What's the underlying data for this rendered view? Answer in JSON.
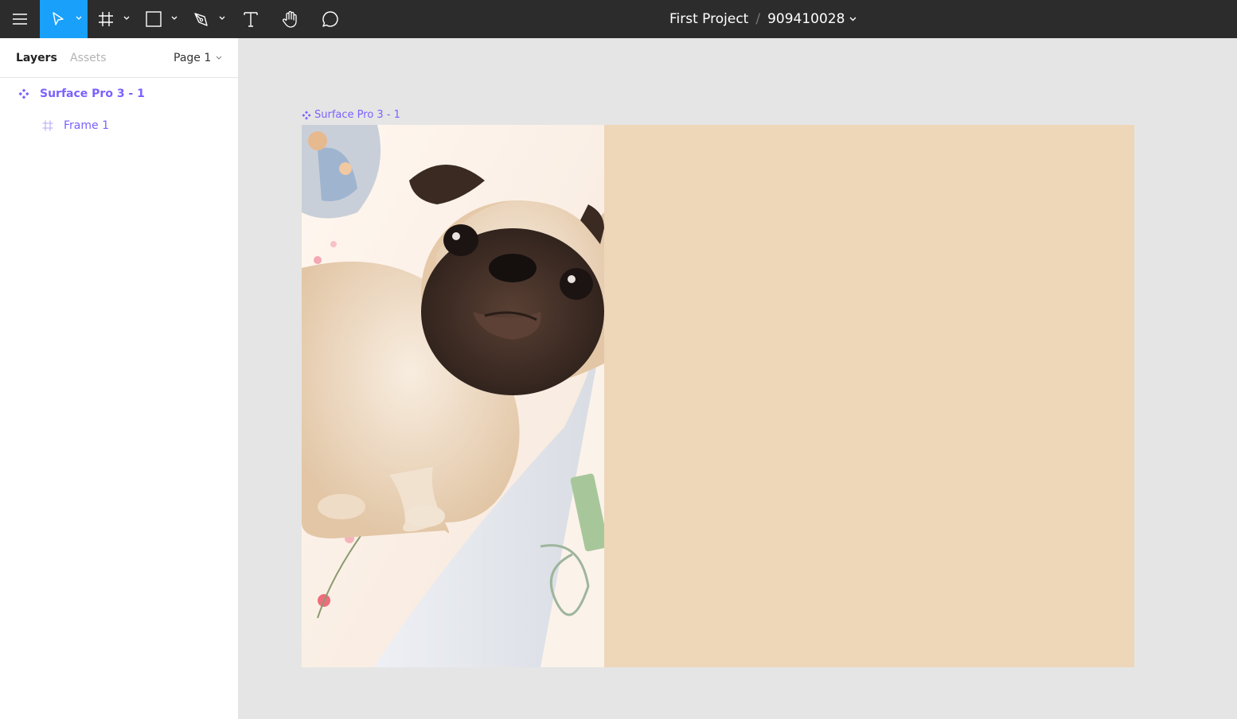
{
  "toolbar": {
    "project_name": "First Project",
    "separator": "/",
    "file_name": "909410028",
    "tools": [
      {
        "icon": "menu-icon"
      },
      {
        "icon": "move-tool-icon",
        "active": true
      },
      {
        "icon": "frame-tool-icon"
      },
      {
        "icon": "rectangle-tool-icon"
      },
      {
        "icon": "pen-tool-icon"
      },
      {
        "icon": "text-tool-icon"
      },
      {
        "icon": "hand-tool-icon"
      },
      {
        "icon": "comment-tool-icon"
      }
    ]
  },
  "panel": {
    "tabs": [
      "Layers",
      "Assets"
    ],
    "active_tab": "Layers",
    "page_label": "Page 1",
    "layers": [
      {
        "label": "Surface Pro 3 - 1",
        "icon": "component-icon",
        "selected": true
      },
      {
        "label": "Frame 1",
        "icon": "frame-icon"
      }
    ]
  },
  "canvas": {
    "frame_label": "Surface Pro 3 - 1",
    "frame_fill": "#eed6b9",
    "image_subject": "pug-photo"
  },
  "colors": {
    "toolbar_bg": "#2c2c2c",
    "accent": "#18a0fb",
    "component_purple": "#7b61ff",
    "canvas_bg": "#e5e5e5"
  }
}
